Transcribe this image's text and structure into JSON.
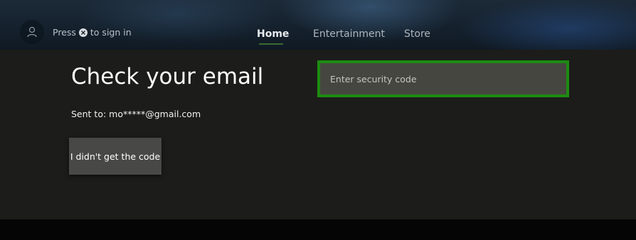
{
  "header": {
    "signin_prefix": "Press",
    "signin_suffix": "to sign in",
    "nav": [
      {
        "label": "Home",
        "active": true
      },
      {
        "label": "Entertainment",
        "active": false
      },
      {
        "label": "Store",
        "active": false
      }
    ]
  },
  "content": {
    "title": "Check your email",
    "sent_to": "Sent to: mo*****@gmail.com",
    "resend_button": "I didn't get the code",
    "security_code": {
      "value": "",
      "placeholder": "Enter security code"
    }
  },
  "colors": {
    "focus_border": "#1d8b12",
    "panel_bg": "#1c1c1a",
    "button_bg": "#484846"
  }
}
